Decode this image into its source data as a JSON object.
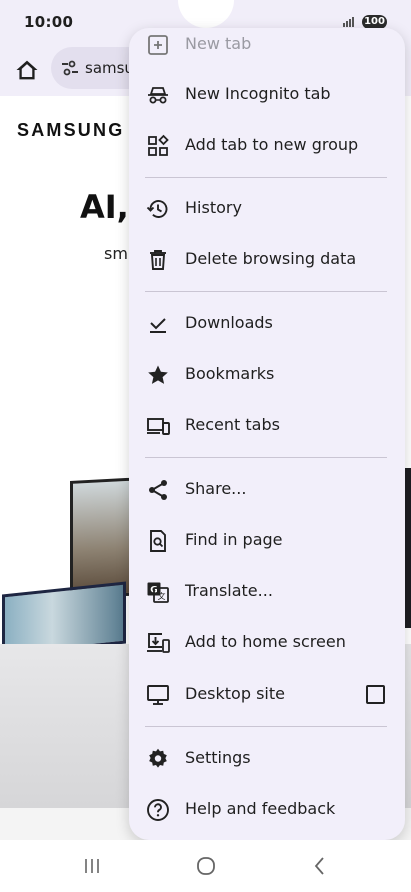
{
  "status_bar": {
    "time": "10:00",
    "battery": "100"
  },
  "toolbar": {
    "url": "samsung.com"
  },
  "page": {
    "brand": "SAMSUNG",
    "hero_title": "AI, ",
    "hero_sub": "sm"
  },
  "menu": {
    "items": [
      {
        "label": "New tab",
        "icon": "new-tab-icon"
      },
      {
        "label": "New Incognito tab",
        "icon": "incognito-icon"
      },
      {
        "label": "Add tab to new group",
        "icon": "tab-group-icon"
      },
      {
        "label": "History",
        "icon": "history-icon"
      },
      {
        "label": "Delete browsing data",
        "icon": "trash-icon"
      },
      {
        "label": "Downloads",
        "icon": "download-icon"
      },
      {
        "label": "Bookmarks",
        "icon": "star-icon"
      },
      {
        "label": "Recent tabs",
        "icon": "devices-icon"
      },
      {
        "label": "Share...",
        "icon": "share-icon"
      },
      {
        "label": "Find in page",
        "icon": "find-in-page-icon"
      },
      {
        "label": "Translate...",
        "icon": "translate-icon"
      },
      {
        "label": "Add to home screen",
        "icon": "add-to-home-screen-icon"
      },
      {
        "label": "Desktop site",
        "icon": "desktop-icon",
        "checkbox": false
      },
      {
        "label": "Settings",
        "icon": "gear-icon"
      },
      {
        "label": "Help and feedback",
        "icon": "help-icon"
      }
    ]
  }
}
